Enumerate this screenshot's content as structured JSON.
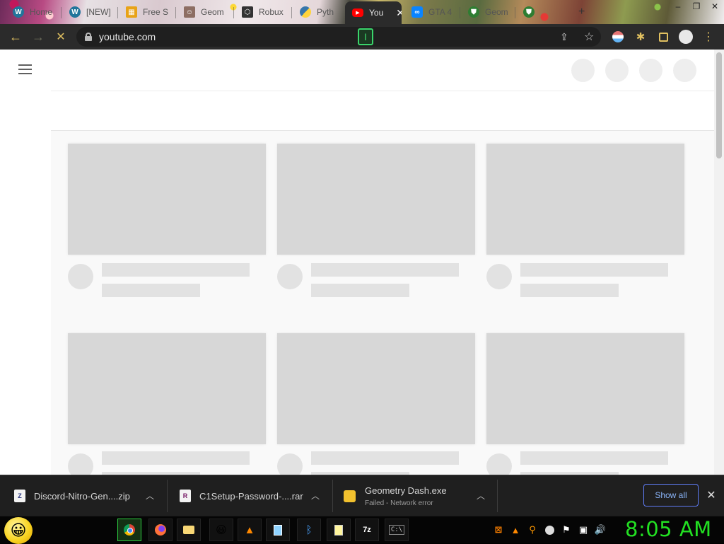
{
  "tabs": [
    {
      "label": "Home",
      "favicon": "wordpress-icon"
    },
    {
      "label": "[NEW]",
      "favicon": "wordpress-icon"
    },
    {
      "label": "Free S",
      "favicon": "gift-icon"
    },
    {
      "label": "Geom",
      "favicon": "profile-icon"
    },
    {
      "label": "Robux",
      "favicon": "robux-icon"
    },
    {
      "label": "Pyth",
      "favicon": "python-icon"
    },
    {
      "label": "You",
      "favicon": "youtube-icon",
      "active": true
    },
    {
      "label": "GTA 4",
      "favicon": "game-icon"
    },
    {
      "label": "Geom",
      "favicon": "shield-icon"
    },
    {
      "label": "",
      "favicon": "shield-icon"
    }
  ],
  "window_controls": {
    "minimize": "‒",
    "maximize": "❐",
    "close": "✕"
  },
  "address_bar": {
    "url": "youtube.com"
  },
  "downloads": [
    {
      "name": "Discord-Nitro-Gen....zip",
      "icon": "zip-icon",
      "icon_letter": "Z",
      "status": ""
    },
    {
      "name": "C1Setup-Password-....rar",
      "icon": "rar-icon",
      "icon_letter": "R",
      "status": ""
    },
    {
      "name": "Geometry Dash.exe",
      "icon": "exe-icon",
      "icon_letter": "",
      "status": "Failed - Network error"
    }
  ],
  "downloads_bar": {
    "show_all": "Show all"
  },
  "taskbar": {
    "apps": [
      "chrome-icon",
      "firefox-icon",
      "folder-icon",
      "emoji-icon",
      "vlc-icon",
      "notepad-icon",
      "bluetooth-icon",
      "notes-icon",
      "7zip-icon",
      "cmd-icon"
    ],
    "app_labels": {
      "sevenzip": "7z",
      "cmd": "C:\\"
    },
    "tray": [
      "xampp-icon",
      "vlc-icon",
      "search-icon",
      "message-icon",
      "flag-icon",
      "network-icon",
      "volume-icon"
    ],
    "clock": "8:05 AM"
  },
  "colors": {
    "clock": "#22e022",
    "show_all_border": "#5f7cf6",
    "active_tab": "#2b2b2b"
  }
}
